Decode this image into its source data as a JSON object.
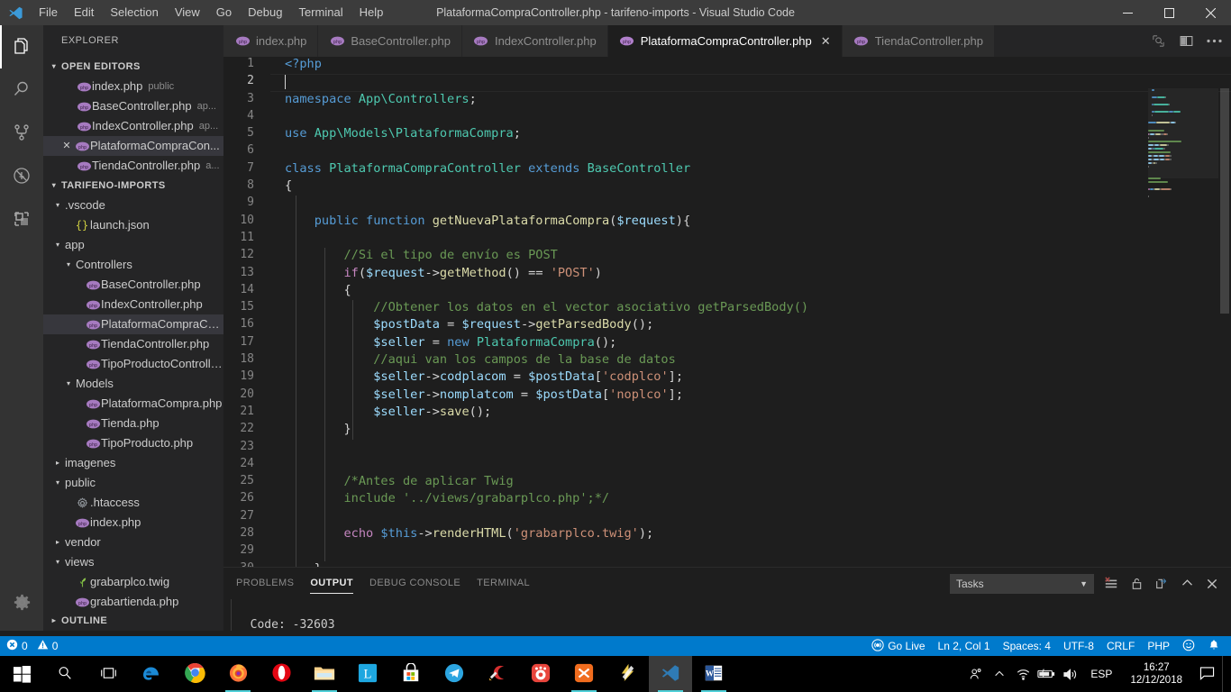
{
  "titlebar": {
    "title": "PlataformaCompraController.php - tarifeno-imports - Visual Studio Code",
    "menus": [
      "File",
      "Edit",
      "Selection",
      "View",
      "Go",
      "Debug",
      "Terminal",
      "Help"
    ],
    "minimize_label": "─",
    "maximize_label": "❐",
    "close_label": "✕"
  },
  "activitybar": {
    "items": [
      {
        "name": "explorer",
        "icon": "files-icon",
        "active": true
      },
      {
        "name": "search",
        "icon": "search-icon",
        "active": false
      },
      {
        "name": "source-control",
        "icon": "source-control-icon",
        "active": false
      },
      {
        "name": "debug",
        "icon": "debug-no-icon",
        "active": false
      },
      {
        "name": "extensions",
        "icon": "extensions-icon",
        "active": false
      }
    ],
    "settings_icon": "gear-icon"
  },
  "sidebar": {
    "title": "EXPLORER",
    "open_editors": {
      "label": "OPEN EDITORS",
      "twisty": "▾",
      "items": [
        {
          "label": "index.php",
          "desc": "public",
          "icon": "php-icon",
          "selected": false,
          "closable": false
        },
        {
          "label": "BaseController.php",
          "desc": "ap...",
          "icon": "php-icon",
          "selected": false,
          "closable": false
        },
        {
          "label": "IndexController.php",
          "desc": "ap...",
          "icon": "php-icon",
          "selected": false,
          "closable": false
        },
        {
          "label": "PlataformaCompraCon...",
          "desc": "",
          "icon": "php-icon",
          "selected": true,
          "closable": true
        },
        {
          "label": "TiendaController.php",
          "desc": "a...",
          "icon": "php-icon",
          "selected": false,
          "closable": false
        }
      ]
    },
    "project": {
      "label": "TARIFENO-IMPORTS",
      "twisty": "▾",
      "tree": [
        {
          "label": ".vscode",
          "indent": 1,
          "kind": "folder",
          "open": true,
          "icon": "folder-icon"
        },
        {
          "label": "launch.json",
          "indent": 2,
          "kind": "file",
          "icon": "json-icon"
        },
        {
          "label": "app",
          "indent": 1,
          "kind": "folder",
          "open": true,
          "icon": "folder-icon"
        },
        {
          "label": "Controllers",
          "indent": 2,
          "kind": "folder",
          "open": true,
          "icon": "folder-icon"
        },
        {
          "label": "BaseController.php",
          "indent": 3,
          "kind": "file",
          "icon": "php-icon"
        },
        {
          "label": "IndexController.php",
          "indent": 3,
          "kind": "file",
          "icon": "php-icon"
        },
        {
          "label": "PlataformaCompraCon...",
          "indent": 3,
          "kind": "file",
          "icon": "php-icon",
          "selected": true
        },
        {
          "label": "TiendaController.php",
          "indent": 3,
          "kind": "file",
          "icon": "php-icon"
        },
        {
          "label": "TipoProductoControlle...",
          "indent": 3,
          "kind": "file",
          "icon": "php-icon"
        },
        {
          "label": "Models",
          "indent": 2,
          "kind": "folder",
          "open": true,
          "icon": "folder-icon"
        },
        {
          "label": "PlataformaCompra.php",
          "indent": 3,
          "kind": "file",
          "icon": "php-icon"
        },
        {
          "label": "Tienda.php",
          "indent": 3,
          "kind": "file",
          "icon": "php-icon"
        },
        {
          "label": "TipoProducto.php",
          "indent": 3,
          "kind": "file",
          "icon": "php-icon"
        },
        {
          "label": "imagenes",
          "indent": 1,
          "kind": "folder",
          "open": false,
          "icon": "folder-icon"
        },
        {
          "label": "public",
          "indent": 1,
          "kind": "folder",
          "open": true,
          "icon": "folder-icon"
        },
        {
          "label": ".htaccess",
          "indent": 2,
          "kind": "file",
          "icon": "gear-file-icon"
        },
        {
          "label": "index.php",
          "indent": 2,
          "kind": "file",
          "icon": "php-icon"
        },
        {
          "label": "vendor",
          "indent": 1,
          "kind": "folder",
          "open": false,
          "icon": "folder-icon"
        },
        {
          "label": "views",
          "indent": 1,
          "kind": "folder",
          "open": true,
          "icon": "folder-icon"
        },
        {
          "label": "grabarplco.twig",
          "indent": 2,
          "kind": "file",
          "icon": "twig-icon"
        },
        {
          "label": "grabartienda.php",
          "indent": 2,
          "kind": "file",
          "icon": "php-icon"
        }
      ]
    },
    "outline": {
      "label": "OUTLINE",
      "twisty": "▸"
    }
  },
  "tabs": {
    "items": [
      {
        "label": "index.php",
        "icon": "php-icon",
        "active": false,
        "closable": false
      },
      {
        "label": "BaseController.php",
        "icon": "php-icon",
        "active": false,
        "closable": false
      },
      {
        "label": "IndexController.php",
        "icon": "php-icon",
        "active": false,
        "closable": false
      },
      {
        "label": "PlataformaCompraController.php",
        "icon": "php-icon",
        "active": true,
        "closable": true
      },
      {
        "label": "TiendaController.php",
        "icon": "php-icon",
        "active": false,
        "closable": false
      }
    ],
    "close_glyph": "✕",
    "actions": [
      {
        "name": "open-changes-icon"
      },
      {
        "name": "split-editor-icon"
      },
      {
        "name": "more-actions-icon"
      }
    ]
  },
  "editor": {
    "active_line": 2,
    "lines": [
      {
        "n": 1,
        "tokens": [
          {
            "t": "<?php",
            "c": "t-tag"
          }
        ]
      },
      {
        "n": 2,
        "tokens": [],
        "cursor": true
      },
      {
        "n": 3,
        "tokens": [
          {
            "t": "namespace ",
            "c": "t-keyword"
          },
          {
            "t": "App\\Controllers",
            "c": "t-class"
          },
          {
            "t": ";",
            "c": "t-punct"
          }
        ]
      },
      {
        "n": 4,
        "tokens": []
      },
      {
        "n": 5,
        "tokens": [
          {
            "t": "use ",
            "c": "t-keyword"
          },
          {
            "t": "App\\Models\\PlataformaCompra",
            "c": "t-class"
          },
          {
            "t": ";",
            "c": "t-punct"
          }
        ]
      },
      {
        "n": 6,
        "tokens": []
      },
      {
        "n": 7,
        "tokens": [
          {
            "t": "class ",
            "c": "t-keyword"
          },
          {
            "t": "PlataformaCompraController",
            "c": "t-class"
          },
          {
            "t": " extends ",
            "c": "t-keyword"
          },
          {
            "t": "BaseController",
            "c": "t-class"
          }
        ]
      },
      {
        "n": 8,
        "tokens": [
          {
            "t": "{",
            "c": "t-punct"
          }
        ]
      },
      {
        "n": 9,
        "tokens": []
      },
      {
        "n": 10,
        "tokens": [
          {
            "t": "    ",
            "c": "t-default"
          },
          {
            "t": "public function ",
            "c": "t-keyword"
          },
          {
            "t": "getNuevaPlataformaCompra",
            "c": "t-func"
          },
          {
            "t": "(",
            "c": "t-punct"
          },
          {
            "t": "$request",
            "c": "t-var"
          },
          {
            "t": "){",
            "c": "t-punct"
          }
        ]
      },
      {
        "n": 11,
        "tokens": []
      },
      {
        "n": 12,
        "tokens": [
          {
            "t": "        //Si el tipo de envío es POST",
            "c": "t-comment"
          }
        ]
      },
      {
        "n": 13,
        "tokens": [
          {
            "t": "        ",
            "c": "t-default"
          },
          {
            "t": "if",
            "c": "t-ctrl"
          },
          {
            "t": "(",
            "c": "t-punct"
          },
          {
            "t": "$request",
            "c": "t-var"
          },
          {
            "t": "->",
            "c": "t-punct"
          },
          {
            "t": "getMethod",
            "c": "t-func"
          },
          {
            "t": "() == ",
            "c": "t-punct"
          },
          {
            "t": "'POST'",
            "c": "t-string"
          },
          {
            "t": ")",
            "c": "t-punct"
          }
        ]
      },
      {
        "n": 14,
        "tokens": [
          {
            "t": "        {",
            "c": "t-punct"
          }
        ]
      },
      {
        "n": 15,
        "tokens": [
          {
            "t": "            //Obtener los datos en el vector asociativo getParsedBody()",
            "c": "t-comment"
          }
        ]
      },
      {
        "n": 16,
        "tokens": [
          {
            "t": "            ",
            "c": "t-default"
          },
          {
            "t": "$postData",
            "c": "t-var"
          },
          {
            "t": " = ",
            "c": "t-punct"
          },
          {
            "t": "$request",
            "c": "t-var"
          },
          {
            "t": "->",
            "c": "t-punct"
          },
          {
            "t": "getParsedBody",
            "c": "t-func"
          },
          {
            "t": "();",
            "c": "t-punct"
          }
        ]
      },
      {
        "n": 17,
        "tokens": [
          {
            "t": "            ",
            "c": "t-default"
          },
          {
            "t": "$seller",
            "c": "t-var"
          },
          {
            "t": " = ",
            "c": "t-punct"
          },
          {
            "t": "new ",
            "c": "t-keyword"
          },
          {
            "t": "PlataformaCompra",
            "c": "t-class"
          },
          {
            "t": "();",
            "c": "t-punct"
          }
        ]
      },
      {
        "n": 18,
        "tokens": [
          {
            "t": "            //aqui van los campos de la base de datos",
            "c": "t-comment"
          }
        ]
      },
      {
        "n": 19,
        "tokens": [
          {
            "t": "            ",
            "c": "t-default"
          },
          {
            "t": "$seller",
            "c": "t-var"
          },
          {
            "t": "->",
            "c": "t-punct"
          },
          {
            "t": "codplacom",
            "c": "t-var"
          },
          {
            "t": " = ",
            "c": "t-punct"
          },
          {
            "t": "$postData",
            "c": "t-var"
          },
          {
            "t": "[",
            "c": "t-punct"
          },
          {
            "t": "'codplco'",
            "c": "t-string"
          },
          {
            "t": "];",
            "c": "t-punct"
          }
        ]
      },
      {
        "n": 20,
        "tokens": [
          {
            "t": "            ",
            "c": "t-default"
          },
          {
            "t": "$seller",
            "c": "t-var"
          },
          {
            "t": "->",
            "c": "t-punct"
          },
          {
            "t": "nomplatcom",
            "c": "t-var"
          },
          {
            "t": " = ",
            "c": "t-punct"
          },
          {
            "t": "$postData",
            "c": "t-var"
          },
          {
            "t": "[",
            "c": "t-punct"
          },
          {
            "t": "'noplco'",
            "c": "t-string"
          },
          {
            "t": "];",
            "c": "t-punct"
          }
        ]
      },
      {
        "n": 21,
        "tokens": [
          {
            "t": "            ",
            "c": "t-default"
          },
          {
            "t": "$seller",
            "c": "t-var"
          },
          {
            "t": "->",
            "c": "t-punct"
          },
          {
            "t": "save",
            "c": "t-func"
          },
          {
            "t": "();",
            "c": "t-punct"
          }
        ]
      },
      {
        "n": 22,
        "tokens": [
          {
            "t": "        }",
            "c": "t-punct"
          }
        ]
      },
      {
        "n": 23,
        "tokens": []
      },
      {
        "n": 24,
        "tokens": []
      },
      {
        "n": 25,
        "tokens": [
          {
            "t": "        /*Antes de aplicar Twig",
            "c": "t-comment"
          }
        ]
      },
      {
        "n": 26,
        "tokens": [
          {
            "t": "        include '../views/grabarplco.php';*/",
            "c": "t-comment"
          }
        ]
      },
      {
        "n": 27,
        "tokens": []
      },
      {
        "n": 28,
        "tokens": [
          {
            "t": "        ",
            "c": "t-default"
          },
          {
            "t": "echo ",
            "c": "t-ctrl"
          },
          {
            "t": "$this",
            "c": "t-keyword"
          },
          {
            "t": "->",
            "c": "t-punct"
          },
          {
            "t": "renderHTML",
            "c": "t-func"
          },
          {
            "t": "(",
            "c": "t-punct"
          },
          {
            "t": "'grabarplco.twig'",
            "c": "t-string"
          },
          {
            "t": ");",
            "c": "t-punct"
          }
        ]
      },
      {
        "n": 29,
        "tokens": []
      },
      {
        "n": 30,
        "tokens": [
          {
            "t": "    }",
            "c": "t-punct"
          }
        ]
      }
    ]
  },
  "panel": {
    "tabs": [
      {
        "label": "PROBLEMS",
        "active": false
      },
      {
        "label": "OUTPUT",
        "active": true
      },
      {
        "label": "DEBUG CONSOLE",
        "active": false
      },
      {
        "label": "TERMINAL",
        "active": false
      }
    ],
    "select_value": "Tasks",
    "select_caret": "▼",
    "actions": [
      {
        "name": "clear-output-icon"
      },
      {
        "name": "lock-icon"
      },
      {
        "name": "open-in-editor-icon"
      },
      {
        "name": "maximize-panel-icon"
      },
      {
        "name": "close-panel-icon"
      }
    ],
    "output_lines": [
      "",
      "  Code: -32603"
    ]
  },
  "statusbar": {
    "errors_icon": "error-icon",
    "errors": "0",
    "warnings_icon": "warning-icon",
    "warnings": "0",
    "go_live_icon": "broadcast-icon",
    "go_live": "Go Live",
    "cursor_position": "Ln 2, Col 1",
    "indentation": "Spaces: 4",
    "encoding": "UTF-8",
    "eol": "CRLF",
    "language": "PHP",
    "feedback_icon": "smiley-icon",
    "bell_icon": "bell-icon",
    "background": "#007acc"
  },
  "taskbar": {
    "items": [
      {
        "name": "start-button",
        "icon": "windows-icon"
      },
      {
        "name": "search-button",
        "icon": "search-icon"
      },
      {
        "name": "task-view-button",
        "icon": "task-view-icon"
      },
      {
        "name": "edge-button",
        "icon": "edge-icon"
      },
      {
        "name": "chrome-button",
        "icon": "chrome-icon"
      },
      {
        "name": "firefox-button",
        "icon": "firefox-icon",
        "running": true
      },
      {
        "name": "opera-button",
        "icon": "opera-icon"
      },
      {
        "name": "file-explorer-button",
        "icon": "folder-icon",
        "running": true
      },
      {
        "name": "lightshot-button",
        "icon": "lightshot-icon"
      },
      {
        "name": "microsoft-store-button",
        "icon": "store-icon"
      },
      {
        "name": "telegram-button",
        "icon": "telegram-icon"
      },
      {
        "name": "ccleaner-button",
        "icon": "ccleaner-icon"
      },
      {
        "name": "gom-player-button",
        "icon": "gom-icon"
      },
      {
        "name": "xampp-button",
        "icon": "xampp-icon",
        "running": true
      },
      {
        "name": "winamp-button",
        "icon": "winamp-icon"
      },
      {
        "name": "vscode-button",
        "icon": "vscode-icon",
        "running": true,
        "active": true
      },
      {
        "name": "word-button",
        "icon": "word-icon",
        "running": true
      }
    ],
    "tray": {
      "people_icon": "people-icon",
      "chevron_icon": "chevron-up-icon",
      "wifi_icon": "wifi-icon",
      "battery_icon": "battery-charging-icon",
      "volume_icon": "volume-icon",
      "language": "ESP",
      "time": "16:27",
      "date": "12/12/2018",
      "notification_icon": "action-center-icon"
    }
  }
}
